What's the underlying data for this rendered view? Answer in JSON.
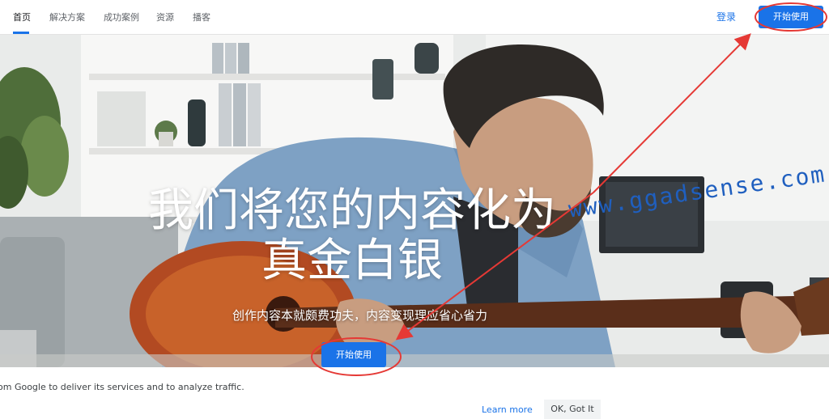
{
  "nav": {
    "items": [
      {
        "label": "首页",
        "active": true
      },
      {
        "label": "解决方案"
      },
      {
        "label": "成功案例"
      },
      {
        "label": "资源"
      },
      {
        "label": "播客"
      }
    ],
    "login": "登录",
    "cta": "开始使用"
  },
  "hero": {
    "title_line1": "我们将您的内容化为",
    "title_line2": "真金白银",
    "subtitle": "创作内容本就颇费功夫，内容变现理应省心省力",
    "cta": "开始使用",
    "watermark": "www.ggadsense.com"
  },
  "cookie": {
    "text": "om Google to deliver its services and to analyze traffic.",
    "learn_more": "Learn more",
    "accept": "OK, Got It"
  },
  "colors": {
    "brand_blue": "#1a73e8",
    "annotation_red": "#e53935"
  }
}
